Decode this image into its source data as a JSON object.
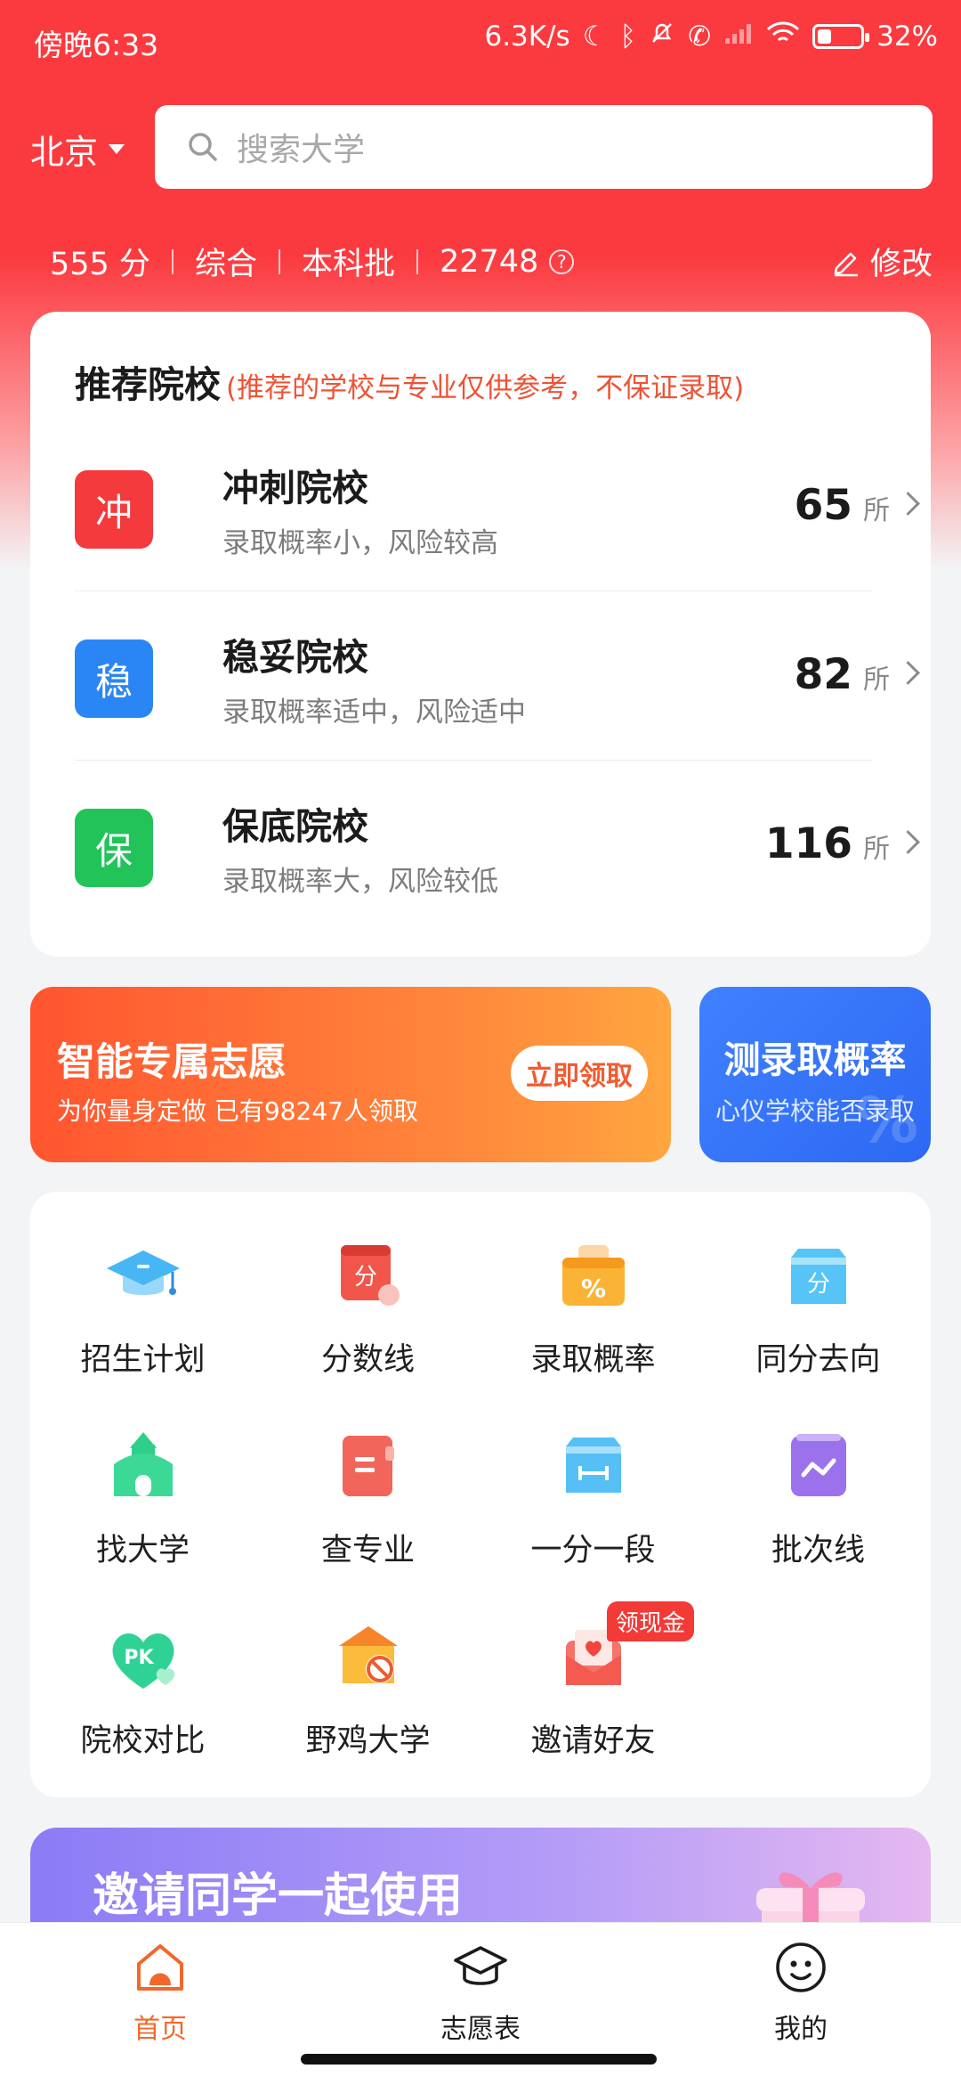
{
  "status_bar": {
    "time": "傍晚6:33",
    "net_speed": "6.3K/s",
    "battery": "32%",
    "battery_level": 0.32
  },
  "header": {
    "city": "北京",
    "search_placeholder": "搜索大学",
    "score": "555 分",
    "subject": "综合",
    "batch": "本科批",
    "rank": "22748",
    "help_mark": "?",
    "edit_label": "修改"
  },
  "recommend": {
    "title": "推荐院校",
    "note": "(推荐的学校与专业仅供参考，不保证录取)",
    "items": [
      {
        "badge": "冲",
        "title": "冲刺院校",
        "subtitle": "录取概率小，风险较高",
        "count": "65",
        "unit": "所",
        "color": "#f43a3c"
      },
      {
        "badge": "稳",
        "title": "稳妥院校",
        "subtitle": "录取概率适中，风险适中",
        "count": "82",
        "unit": "所",
        "color": "#2b86f5"
      },
      {
        "badge": "保",
        "title": "保底院校",
        "subtitle": "录取概率大，风险较低",
        "count": "116",
        "unit": "所",
        "color": "#22c45a"
      }
    ]
  },
  "banner_left": {
    "title": "智能专属志愿",
    "subtitle": "为你量身定做 已有98247人领取",
    "button": "立即领取"
  },
  "banner_right": {
    "title": "测录取概率",
    "subtitle": "心仪学校能否录取",
    "watermark": "%"
  },
  "tools": [
    {
      "label": "招生计划",
      "icon": "graduation-cap-icon"
    },
    {
      "label": "分数线",
      "icon": "score-icon"
    },
    {
      "label": "录取概率",
      "icon": "percent-basket-icon"
    },
    {
      "label": "同分去向",
      "icon": "same-score-icon"
    },
    {
      "label": "找大学",
      "icon": "building-icon"
    },
    {
      "label": "查专业",
      "icon": "book-icon"
    },
    {
      "label": "一分一段",
      "icon": "ruler-icon"
    },
    {
      "label": "批次线",
      "icon": "chart-line-icon"
    },
    {
      "label": "院校对比",
      "icon": "pk-heart-icon"
    },
    {
      "label": "野鸡大学",
      "icon": "warning-school-icon"
    },
    {
      "label": "邀请好友",
      "icon": "envelope-heart-icon",
      "tag": "领现金"
    }
  ],
  "invite_banner": {
    "title": "邀请同学一起使用"
  },
  "tabs": [
    {
      "label": "首页",
      "icon": "home-icon",
      "active": true
    },
    {
      "label": "志愿表",
      "icon": "mortarboard-icon",
      "active": false
    },
    {
      "label": "我的",
      "icon": "smiley-icon",
      "active": false
    }
  ],
  "colors": {
    "primary_red": "#fb3a3f",
    "active_tab": "#f0682a"
  }
}
